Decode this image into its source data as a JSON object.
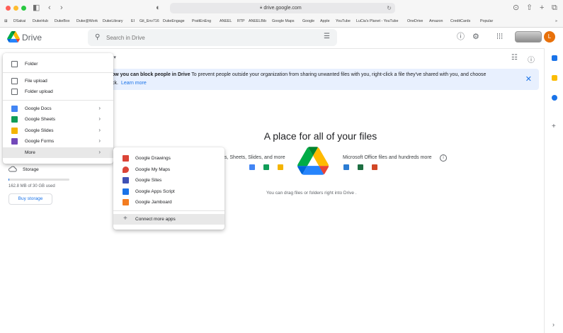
{
  "browser": {
    "url": "drive.google.com",
    "bookmarks": [
      "DSakai",
      "DukeHub",
      "DukeBox",
      "Duke@Work",
      "DukeLibrary",
      "EI",
      "Git_Env716",
      "DukeEngage",
      "PrattEnEng",
      "ANEEL",
      "RTP",
      "ANEELBib",
      "Google Maps",
      "Google",
      "Apple",
      "YouTube",
      "LuCia's Planet - YouTube",
      "OneDrive",
      "Amazon",
      "CreditCards",
      "Popular"
    ]
  },
  "header": {
    "brand": "Drive",
    "search_placeholder": "Search in Drive",
    "avatar_letter": "L"
  },
  "main": {
    "title_fragment": "e",
    "banner": {
      "line1_bold": "ow you can block people in Drive",
      "line1_rest": "To prevent people outside your organization from sharing unwanted files with you, right-click a file they've shared with you, and choose",
      "line2_prefix": "ck.",
      "learn_more": "Learn more"
    },
    "empty_title": "A place for all of your files",
    "files_left": "s, Sheets, Slides, and more",
    "files_right": "Microsoft Office files and hundreds more",
    "drag_hint": "You can drag files or folders right into Drive ."
  },
  "storage": {
    "label": "Storage",
    "used_text": "162.8 MB of 30 GB used",
    "used_fraction": 0.0053,
    "buy_label": "Buy storage"
  },
  "new_menu": {
    "items": [
      {
        "label": "Folder",
        "icon": "folder-plus-icon"
      },
      {
        "label": "File upload",
        "icon": "file-upload-icon"
      },
      {
        "label": "Folder upload",
        "icon": "folder-upload-icon"
      },
      {
        "label": "Google Docs",
        "icon": "google-docs-icon"
      },
      {
        "label": "Google Sheets",
        "icon": "google-sheets-icon"
      },
      {
        "label": "Google Slides",
        "icon": "google-slides-icon"
      },
      {
        "label": "Google Forms",
        "icon": "google-forms-icon"
      },
      {
        "label": "More",
        "icon": "more-icon"
      }
    ]
  },
  "more_menu": {
    "items": [
      {
        "label": "Google Drawings",
        "icon": "google-drawings-icon"
      },
      {
        "label": "Google My Maps",
        "icon": "google-my-maps-icon"
      },
      {
        "label": "Google Sites",
        "icon": "google-sites-icon"
      },
      {
        "label": "Google Apps Script",
        "icon": "google-apps-script-icon"
      },
      {
        "label": "Google Jamboard",
        "icon": "google-jamboard-icon"
      },
      {
        "label": "Connect more apps",
        "icon": "plus-icon"
      }
    ]
  },
  "colors": {
    "docs": "#4285f4",
    "sheets": "#0f9d58",
    "slides": "#f4b400",
    "forms": "#7248b9",
    "drawings": "#db4437",
    "my_maps": "#db4437",
    "sites": "#3f51b5",
    "apps_script": "#1a73e8",
    "jamboard": "#f37c20",
    "accent": "#1a73e8",
    "avatar": "#e8710a"
  }
}
